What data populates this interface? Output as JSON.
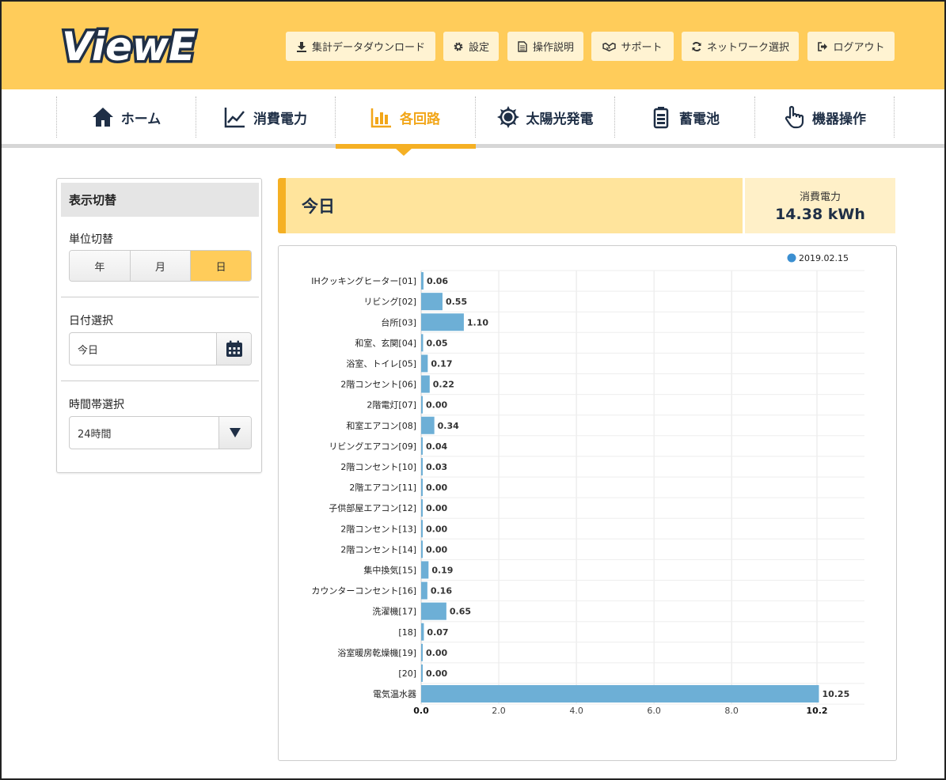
{
  "app": {
    "logo_text": "ViewE"
  },
  "toolbar": {
    "download": "集計データダウンロード",
    "settings": "設定",
    "manual": "操作説明",
    "support": "サポート",
    "network": "ネットワーク選択",
    "logout": "ログアウト"
  },
  "nav": {
    "home": "ホーム",
    "power": "消費電力",
    "circuits": "各回路",
    "solar": "太陽光発電",
    "battery": "蓄電池",
    "device": "機器操作",
    "active": "circuits"
  },
  "sidebar": {
    "title": "表示切替",
    "unit_label": "単位切替",
    "units": [
      "年",
      "月",
      "日"
    ],
    "unit_selected": "日",
    "date_label": "日付選択",
    "date_value": "今日",
    "time_label": "時間帯選択",
    "time_value": "24時間"
  },
  "summary": {
    "period": "今日",
    "consumption_label": "消費電力",
    "consumption_value": "14.38 kWh"
  },
  "colors": {
    "accent": "#ffcc5a",
    "accent_dark": "#f5b024",
    "bar": "#6dafd6",
    "legend_dot": "#3b8fd1",
    "nav_text": "#1f2f46"
  },
  "chart_data": {
    "type": "bar",
    "orientation": "horizontal",
    "legend": [
      "2019.02.15"
    ],
    "categories": [
      "IHクッキングヒーター[01]",
      "リビング[02]",
      "台所[03]",
      "和室、玄関[04]",
      "浴室、トイレ[05]",
      "2階コンセント[06]",
      "2階電灯[07]",
      "和室エアコン[08]",
      "リビングエアコン[09]",
      "2階コンセント[10]",
      "2階エアコン[11]",
      "子供部屋エアコン[12]",
      "2階コンセント[13]",
      "2階コンセント[14]",
      "集中換気[15]",
      "カウンターコンセント[16]",
      "洗濯機[17]",
      "[18]",
      "浴室暖房乾燥機[19]",
      "[20]",
      "電気温水器"
    ],
    "values": [
      0.06,
      0.55,
      1.1,
      0.05,
      0.17,
      0.22,
      0.0,
      0.34,
      0.04,
      0.03,
      0.0,
      0.0,
      0.0,
      0.0,
      0.19,
      0.16,
      0.65,
      0.07,
      0.0,
      0.0,
      10.25
    ],
    "value_labels": [
      "0.06",
      "0.55",
      "1.10",
      "0.05",
      "0.17",
      "0.22",
      "0.00",
      "0.34",
      "0.04",
      "0.03",
      "0.00",
      "0.00",
      "0.00",
      "0.00",
      "0.19",
      "0.16",
      "0.65",
      "0.07",
      "0.00",
      "0.00",
      "10.25"
    ],
    "xticks": [
      "0.0",
      "2.0",
      "4.0",
      "6.0",
      "8.0",
      "10.2"
    ],
    "xlim": [
      0,
      10.2
    ],
    "grid": true
  }
}
